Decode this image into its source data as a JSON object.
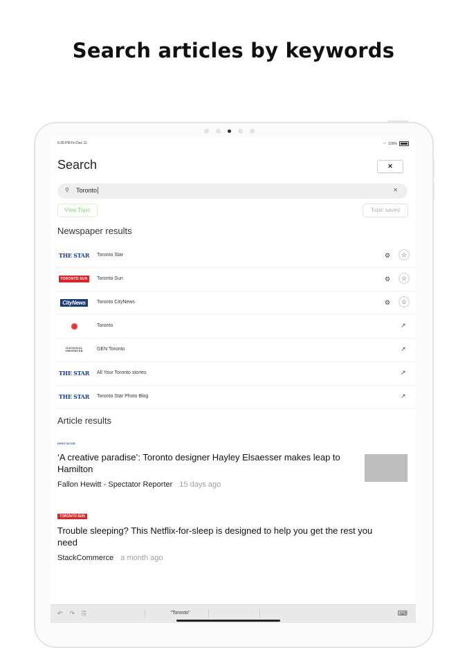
{
  "headline": "Search articles by keywords",
  "status_bar": {
    "time": "6:35 PM  Fri Dec 11",
    "battery": "100%"
  },
  "header": {
    "title": "Search",
    "close_icon": "✕"
  },
  "search": {
    "value": "Toronto",
    "search_icon": "⚲",
    "clear_icon": "✕"
  },
  "topic": {
    "view_label": "View Topic",
    "saved_label": "Topic saved"
  },
  "sections": {
    "newspapers": "Newspaper results",
    "articles": "Article results"
  },
  "newspapers": [
    {
      "logo": "THE STAR",
      "name": "Toronto Star",
      "action": "follow"
    },
    {
      "logo": "TORONTO SUN",
      "name": "Toronto Sun",
      "action": "follow"
    },
    {
      "logo": "CityNews",
      "name": "Toronto CityNews",
      "action": "follow"
    },
    {
      "logo": "cbc-gem-logo",
      "name": "Toronto",
      "action": "open"
    },
    {
      "logo": "NATIONAL OBSERVER",
      "name": "GEN Toronto",
      "action": "open"
    },
    {
      "logo": "THE STAR",
      "name": "All Your Toronto stories",
      "action": "open"
    },
    {
      "logo": "THE STAR",
      "name": "Toronto Star Photo Blog",
      "action": "open"
    }
  ],
  "articles": [
    {
      "source_logo": "SPECTATOR",
      "title": "‘A creative paradise’: Toronto designer Hayley Elsaesser makes leap to Hamilton",
      "author": "Fallon Hewitt - Spectator Reporter",
      "age": "15 days ago",
      "has_thumbnail": true
    },
    {
      "source_logo": "TORONTO SUN",
      "title": "Trouble sleeping? This Netflix-for-sleep is designed to help you get the rest you need",
      "author": "StackCommerce",
      "age": "a month ago",
      "has_thumbnail": false
    }
  ],
  "keyboard_bar": {
    "suggestion": "\"Toronto\"",
    "undo_icon": "↶",
    "redo_icon": "↷",
    "paste_icon": "⎘",
    "keyboard_icon": "⌨"
  },
  "colors": {
    "accent_green": "#8fcf6f",
    "star_blue": "#1d3f86",
    "sun_red": "#d6262b"
  }
}
